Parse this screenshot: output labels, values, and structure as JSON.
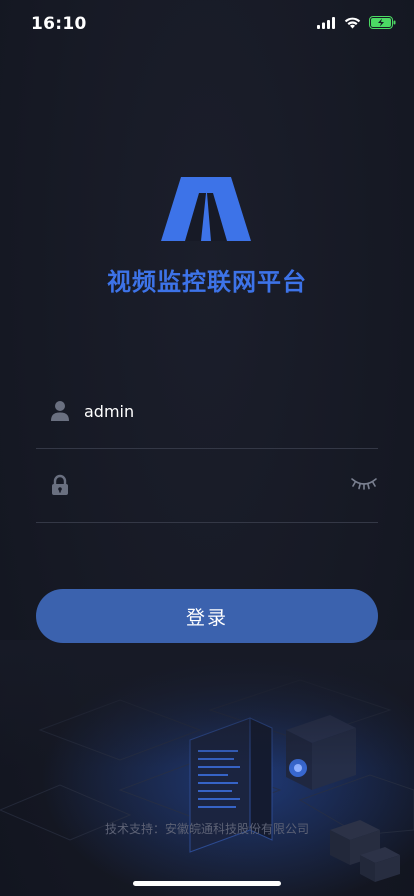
{
  "status_bar": {
    "time": "16:10",
    "icons": [
      "signal-icon",
      "wifi-icon",
      "battery-charging-icon"
    ],
    "battery_color": "#4cd964"
  },
  "app": {
    "title": "视频监控联网平台",
    "logo_icon": "a-shaped-logo-icon",
    "accent_color": "#3d73e8"
  },
  "login": {
    "username_value": "admin",
    "username_placeholder": "",
    "password_value": "",
    "password_placeholder": "",
    "button_label": "登录",
    "button_color": "#3b62ae"
  },
  "footer": {
    "support_text": "技术支持：安徽皖通科技股份有限公司"
  }
}
